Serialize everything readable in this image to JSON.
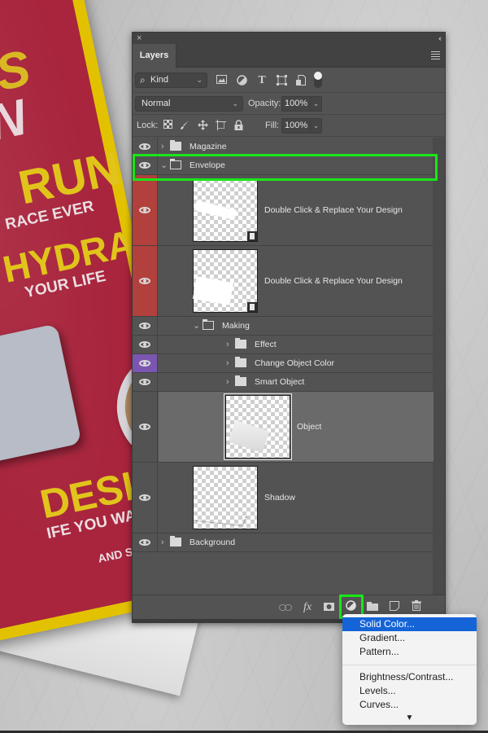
{
  "poster": {
    "title_line1": "NESS",
    "title_line2": "SIGN",
    "headline1": "RUN",
    "sub1": "TEST RACE EVER",
    "headline2": "HYDRATE",
    "sub2": "YOUR LIFE",
    "headline3": "DESIGN",
    "sub3": "IFE YOU WANT",
    "sub4": "AND SO MUCH MORE INS"
  },
  "panel": {
    "close_glyph": "×",
    "collapse_glyph": "‹‹",
    "tab_label": "Layers",
    "filter": {
      "kind_label": "Kind",
      "search_glyph": "⌕"
    },
    "blend_mode": "Normal",
    "opacity_label": "Opacity:",
    "opacity_value": "100%",
    "lock_label": "Lock:",
    "fill_label": "Fill:",
    "fill_value": "100%",
    "filter_icons": [
      "image-filter-icon",
      "adjustment-filter-icon",
      "type-filter-icon",
      "shape-filter-icon",
      "smart-object-filter-icon"
    ],
    "lock_icons": [
      "lock-transparent-icon",
      "lock-image-icon",
      "lock-position-icon",
      "lock-artboard-icon",
      "lock-all-icon"
    ]
  },
  "layers": [
    {
      "name": "Magazine",
      "type": "group",
      "expanded": false,
      "eye_color": "none"
    },
    {
      "name": "Envelope",
      "type": "group",
      "expanded": true,
      "eye_color": "none",
      "highlighted": true
    },
    {
      "name": "Double Click & Replace Your Design",
      "type": "smart-object",
      "eye_color": "red"
    },
    {
      "name": "Double Click & Replace Your Design",
      "type": "smart-object",
      "eye_color": "red"
    },
    {
      "name": "Making",
      "type": "group",
      "expanded": true,
      "eye_color": "none"
    },
    {
      "name": "Effect",
      "type": "group",
      "expanded": false,
      "eye_color": "none"
    },
    {
      "name": "Change Object Color",
      "type": "group",
      "expanded": false,
      "eye_color": "violet"
    },
    {
      "name": "Smart Object",
      "type": "group",
      "expanded": false,
      "eye_color": "none"
    },
    {
      "name": "Object",
      "type": "pixel",
      "eye_color": "none",
      "selected": true
    },
    {
      "name": "Shadow",
      "type": "pixel",
      "eye_color": "none"
    },
    {
      "name": "Background",
      "type": "group",
      "expanded": false,
      "eye_color": "none"
    }
  ],
  "footer": {
    "link_glyph": "⊖",
    "fx_glyph": "fx",
    "mask_glyph": "◙",
    "adjustment_glyph": "◐",
    "group_glyph": "▬",
    "new_layer_glyph": "◻",
    "trash_glyph": "🗑"
  },
  "adjustment_menu": {
    "items_top": [
      "Solid Color...",
      "Gradient...",
      "Pattern..."
    ],
    "items_bottom": [
      "Brightness/Contrast...",
      "Levels...",
      "Curves..."
    ],
    "selected": "Solid Color...",
    "more_glyph": "▼"
  },
  "colors": {
    "panel_bg": "#535353",
    "eye_red": "#b2403c",
    "eye_violet": "#7b56b0",
    "selected_row": "#6a6a6a",
    "highlight_green": "#19e619",
    "menu_selected": "#1464d8"
  }
}
